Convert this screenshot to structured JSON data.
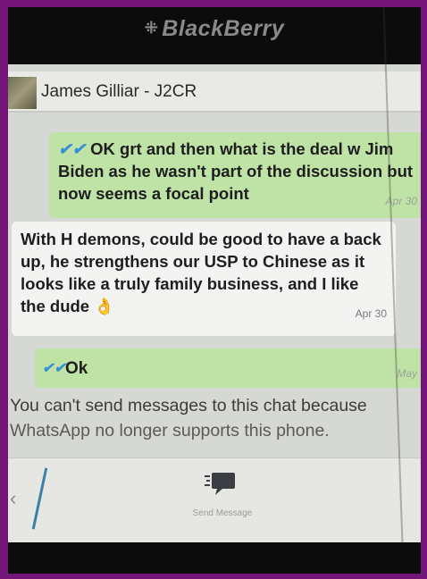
{
  "device": {
    "brand": "BlackBerry"
  },
  "chat": {
    "contact_name": "James Gilliar - J2CR"
  },
  "messages": [
    {
      "direction": "out",
      "text": "OK grt and then what is the deal w Jim Biden as he wasn't part of the discussion but now seems a focal point",
      "time": "Apr 30",
      "status_icon": "double-check-icon"
    },
    {
      "direction": "in",
      "text": "With H demons, could be good to have a back up,  he strengthens our USP to Chinese as it looks like a truly family business, and I like the dude",
      "emoji": "👌",
      "time": "Apr 30"
    },
    {
      "direction": "out",
      "text": "Ok",
      "time": "May",
      "status_icon": "double-check-icon"
    }
  ],
  "notice": {
    "line1": "You can't send messages to this chat because",
    "line2": "WhatsApp no longer supports this phone."
  },
  "bottom_bar": {
    "send_label": "Send Message",
    "send_icon": "send-message-icon"
  },
  "colors": {
    "frame": "#74157a",
    "outgoing_bubble": "#bfe3a6",
    "incoming_bubble": "#f3f3f1",
    "check": "#3a8fd4"
  }
}
